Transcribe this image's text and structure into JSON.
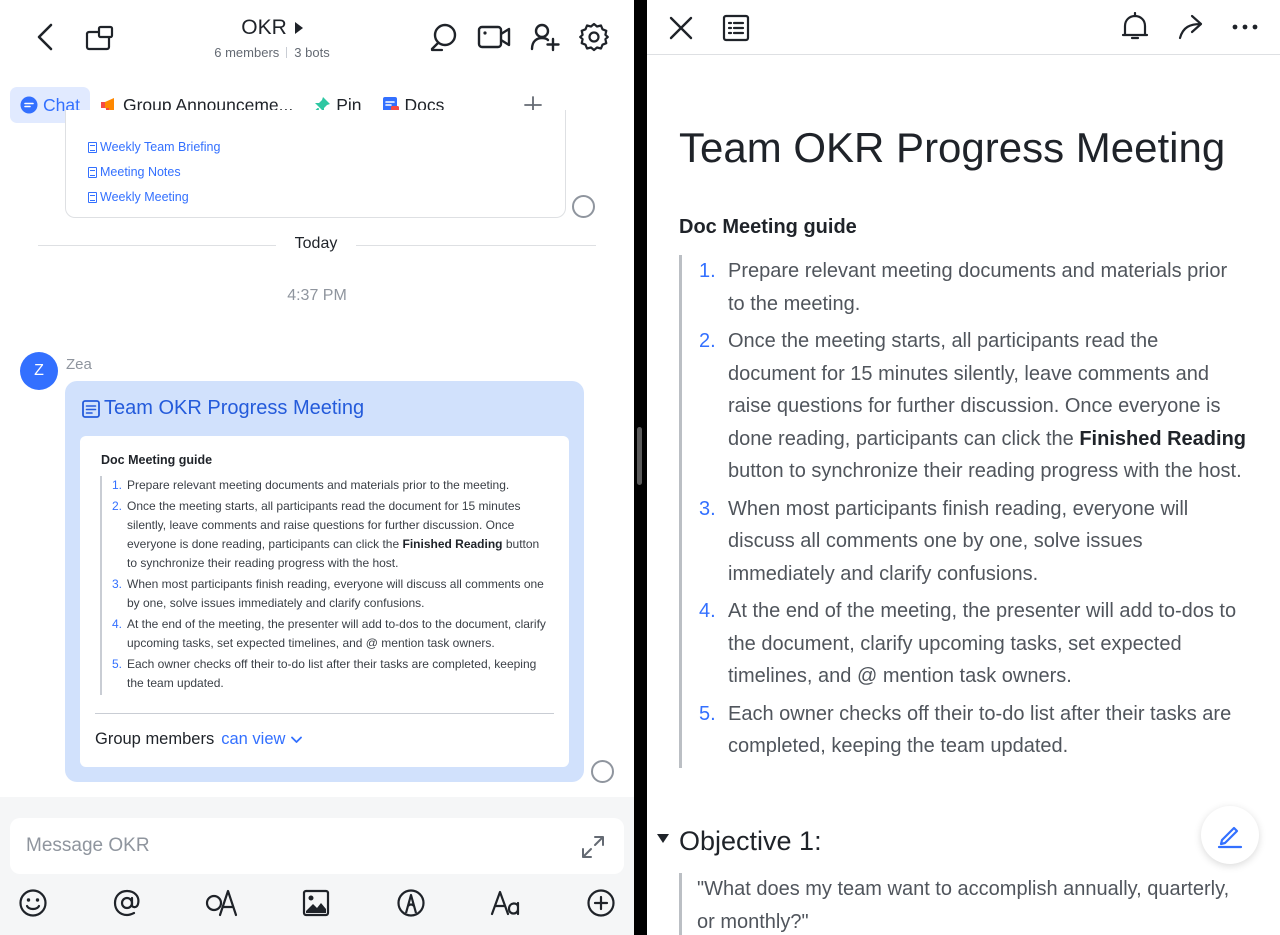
{
  "chat": {
    "title": "OKR",
    "members": "6 members",
    "bots": "3 bots",
    "tabs": [
      {
        "label": "Chat",
        "icon": "chat-bubble-icon"
      },
      {
        "label": "Group Announceme...",
        "icon": "megaphone-icon"
      },
      {
        "label": "Pin",
        "icon": "pin-icon"
      },
      {
        "label": "Docs",
        "icon": "docs-icon"
      }
    ],
    "previous_links": [
      "Weekly Team Briefing",
      "Meeting Notes",
      "Weekly Meeting"
    ],
    "today_label": "Today",
    "time_label": "4:37 PM",
    "message": {
      "avatar_initial": "Z",
      "sender": "Zea",
      "card_title": "Team OKR Progress Meeting",
      "preview_heading": "Doc Meeting guide",
      "preview_items": [
        {
          "num": "1.",
          "text": "Prepare relevant meeting documents and materials prior to the meeting."
        },
        {
          "num": "2.",
          "text_before": "Once the meeting starts, all participants read the document for 15 minutes silently, leave comments and raise questions for further discussion. Once everyone is done reading, participants can click the ",
          "bold": "Finished Reading",
          "text_after": " button to synchronize their reading progress with the host."
        },
        {
          "num": "3.",
          "text": "When most participants finish reading, everyone will discuss all comments one by one, solve issues immediately and clarify confusions."
        },
        {
          "num": "4.",
          "text": "At the end of the meeting, the presenter will add to-dos to the document, clarify upcoming tasks, set expected timelines, and @ mention task owners."
        },
        {
          "num": "5.",
          "text": "Each owner checks off their to-do list after their tasks are completed, keeping the team updated."
        }
      ],
      "permission_label": "Group members",
      "permission_value": "can view"
    },
    "composer_placeholder": "Message OKR"
  },
  "doc": {
    "title": "Team OKR Progress Meeting",
    "guide_heading": "Doc Meeting guide",
    "items": [
      {
        "num": "1.",
        "text": "Prepare relevant meeting documents and materials prior to the meeting."
      },
      {
        "num": "2.",
        "text_before": "Once the meeting starts, all participants read the document for 15 minutes silently, leave comments and raise questions for further discussion. Once everyone is done reading, participants can click the ",
        "bold": "Finished Reading",
        "text_after": " button to synchronize their reading progress with the host."
      },
      {
        "num": "3.",
        "text": "When most participants finish reading, everyone will discuss all comments one by one, solve issues immediately and clarify confusions."
      },
      {
        "num": "4.",
        "text": "At the end of the meeting, the presenter will add to-dos to the document, clarify upcoming tasks, set expected timelines, and @ mention task owners."
      },
      {
        "num": "5.",
        "text": "Each owner checks off their to-do list after their tasks are completed, keeping the team updated."
      }
    ],
    "objective_heading": "Objective 1:",
    "objective_quote": "\"What does my team want to accomplish annually, quarterly, or monthly?\""
  },
  "colors": {
    "accent": "#3370ff",
    "card_bg": "#d1e1fc",
    "divider": "#000000"
  }
}
